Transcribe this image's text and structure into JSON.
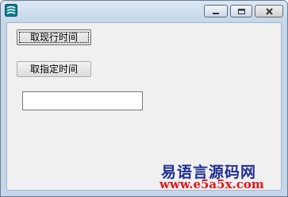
{
  "window": {
    "title": "",
    "controls": {
      "minimize": "minimize-icon",
      "maximize": "maximize-icon",
      "close": "close-icon"
    }
  },
  "buttons": {
    "get_current_time": "取现行时间",
    "get_specified_time": "取指定时间"
  },
  "textbox": {
    "value": ""
  },
  "watermark": {
    "title": "易语言源码网",
    "url": "www.e5a5x.com"
  },
  "colors": {
    "title_bar": "#c6d7ea",
    "client": "#f0f0f0",
    "watermark_title": "#1f2f92",
    "watermark_url": "#e0161c"
  }
}
